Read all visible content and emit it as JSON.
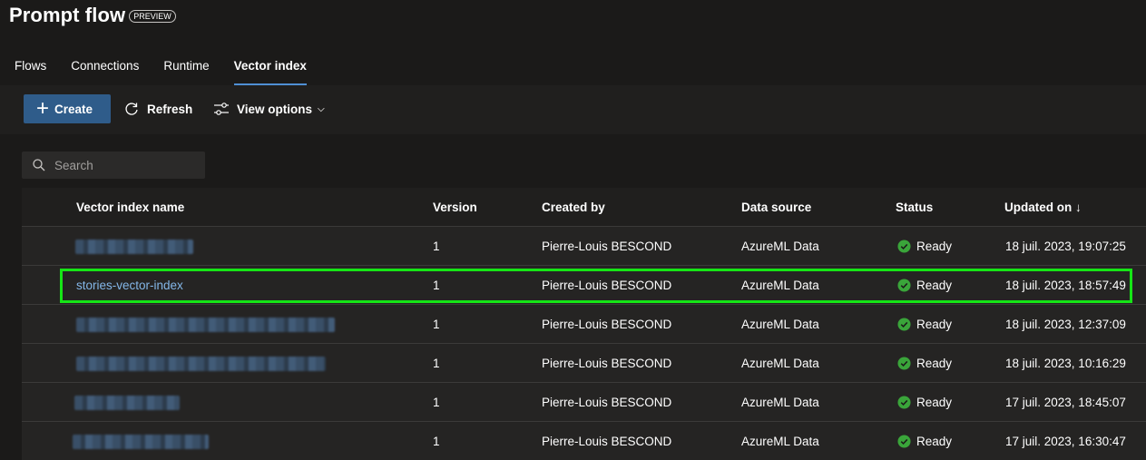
{
  "header": {
    "title": "Prompt flow",
    "badge": "PREVIEW"
  },
  "tabs": [
    {
      "label": "Flows",
      "active": false
    },
    {
      "label": "Connections",
      "active": false
    },
    {
      "label": "Runtime",
      "active": false
    },
    {
      "label": "Vector index",
      "active": true
    }
  ],
  "toolbar": {
    "create_label": "Create",
    "refresh_label": "Refresh",
    "view_options_label": "View options"
  },
  "search": {
    "placeholder": "Search"
  },
  "table": {
    "columns": [
      "Vector index name",
      "Version",
      "Created by",
      "Data source",
      "Status",
      "Updated on ↓"
    ],
    "rows": [
      {
        "name": "",
        "redacted": true,
        "version": "1",
        "created_by": "Pierre-Louis BESCOND",
        "data_source": "AzureML Data",
        "status": "Ready",
        "updated_on": "18 juil. 2023, 19:07:25"
      },
      {
        "name": "stories-vector-index",
        "redacted": false,
        "version": "1",
        "created_by": "Pierre-Louis BESCOND",
        "data_source": "AzureML Data",
        "status": "Ready",
        "updated_on": "18 juil. 2023, 18:57:49"
      },
      {
        "name": "",
        "redacted": true,
        "version": "1",
        "created_by": "Pierre-Louis BESCOND",
        "data_source": "AzureML Data",
        "status": "Ready",
        "updated_on": "18 juil. 2023, 12:37:09"
      },
      {
        "name": "",
        "redacted": true,
        "version": "1",
        "created_by": "Pierre-Louis BESCOND",
        "data_source": "AzureML Data",
        "status": "Ready",
        "updated_on": "18 juil. 2023, 10:16:29"
      },
      {
        "name": "",
        "redacted": true,
        "version": "1",
        "created_by": "Pierre-Louis BESCOND",
        "data_source": "AzureML Data",
        "status": "Ready",
        "updated_on": "17 juil. 2023, 18:45:07"
      },
      {
        "name": "",
        "redacted": true,
        "version": "1",
        "created_by": "Pierre-Louis BESCOND",
        "data_source": "AzureML Data",
        "status": "Ready",
        "updated_on": "17 juil. 2023, 16:30:47"
      }
    ]
  },
  "colors": {
    "accent": "#2f5c8a",
    "link": "#84b7e8",
    "status_ready": "#3aa53a",
    "highlight": "#16e516"
  },
  "icons": [
    "plus-icon",
    "refresh-icon",
    "sliders-icon",
    "chevron-down-icon",
    "search-icon",
    "check-circle-icon"
  ]
}
